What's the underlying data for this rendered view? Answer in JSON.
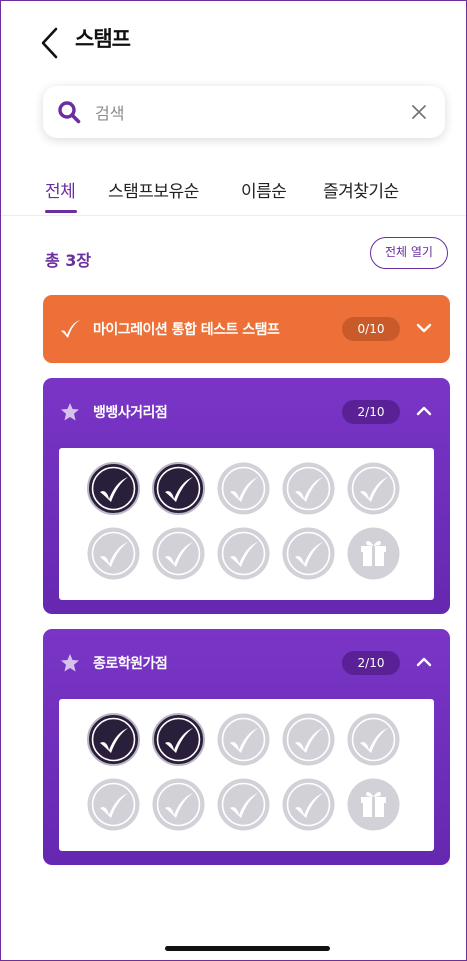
{
  "header": {
    "title": "스탬프"
  },
  "search": {
    "placeholder": "검색"
  },
  "tabs": [
    {
      "label": "전체",
      "active": true
    },
    {
      "label": "스탬프보유순",
      "active": false
    },
    {
      "label": "이름순",
      "active": false
    },
    {
      "label": "즐겨찾기순",
      "active": false
    }
  ],
  "summary": {
    "total_label": "총 3장",
    "open_all_label": "전체 열기"
  },
  "cards": [
    {
      "name": "마이그레이션 통합 테스트 스탬프",
      "count": "0/10",
      "expanded": false,
      "color": "#ec7037",
      "icon": "check-swoosh-icon"
    },
    {
      "name": "뱅뱅사거리점",
      "count": "2/10",
      "expanded": true,
      "color": "#7a35c6",
      "icon": "star-icon",
      "stamps_collected": 2,
      "stamps_total": 10
    },
    {
      "name": "종로학원가점",
      "count": "2/10",
      "expanded": true,
      "color": "#7a35c6",
      "icon": "star-icon",
      "stamps_collected": 2,
      "stamps_total": 10
    }
  ],
  "colors": {
    "accent": "#6a2ea0",
    "orange": "#ec7037",
    "purple": "#7a35c6",
    "stamp_filled": "#2a1f3a",
    "stamp_empty": "#d3d1d8"
  }
}
